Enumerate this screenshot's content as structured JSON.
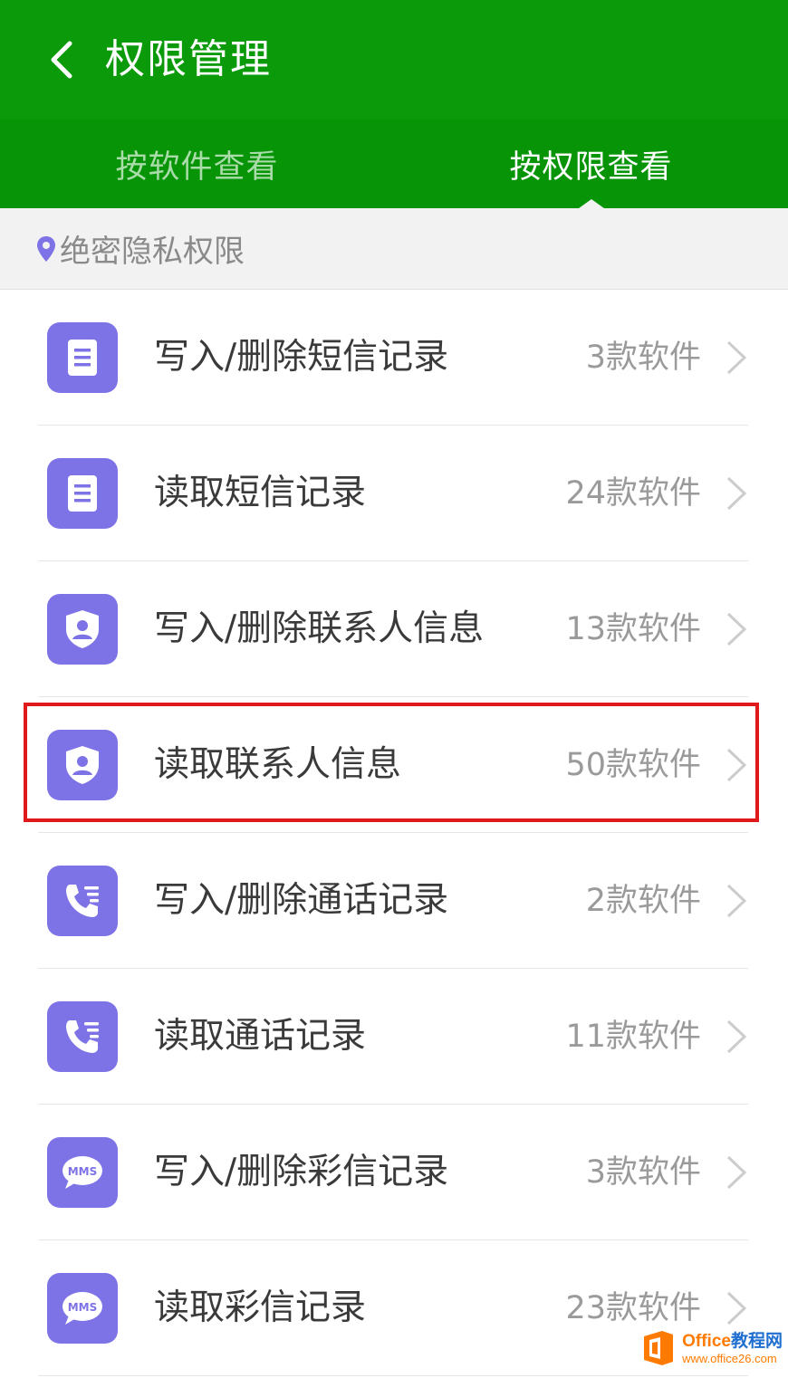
{
  "header": {
    "title": "权限管理",
    "background": "#0a9a0a"
  },
  "tabs": [
    {
      "label": "按软件查看",
      "active": false
    },
    {
      "label": "按权限查看",
      "active": true
    }
  ],
  "section": {
    "label": "绝密隐私权限",
    "icon": "location-pin-icon"
  },
  "permissions": [
    {
      "label": "写入/删除短信记录",
      "count": "3款软件",
      "icon": "document-icon"
    },
    {
      "label": "读取短信记录",
      "count": "24款软件",
      "icon": "document-icon"
    },
    {
      "label": "写入/删除联系人信息",
      "count": "13款软件",
      "icon": "shield-user-icon"
    },
    {
      "label": "读取联系人信息",
      "count": "50款软件",
      "icon": "shield-user-icon",
      "highlighted": true
    },
    {
      "label": "写入/删除通话记录",
      "count": "2款软件",
      "icon": "call-log-icon"
    },
    {
      "label": "读取通话记录",
      "count": "11款软件",
      "icon": "call-log-icon"
    },
    {
      "label": "写入/删除彩信记录",
      "count": "3款软件",
      "icon": "mms-bubble-icon"
    },
    {
      "label": "读取彩信记录",
      "count": "23款软件",
      "icon": "mms-bubble-icon"
    }
  ],
  "icon_badge_text": "MMS",
  "colors": {
    "accent": "#7e73e6",
    "highlight_border": "#e01a1a"
  },
  "watermark": {
    "brand_a": "Office",
    "brand_b": "教程网",
    "url": "www.office26.com"
  }
}
